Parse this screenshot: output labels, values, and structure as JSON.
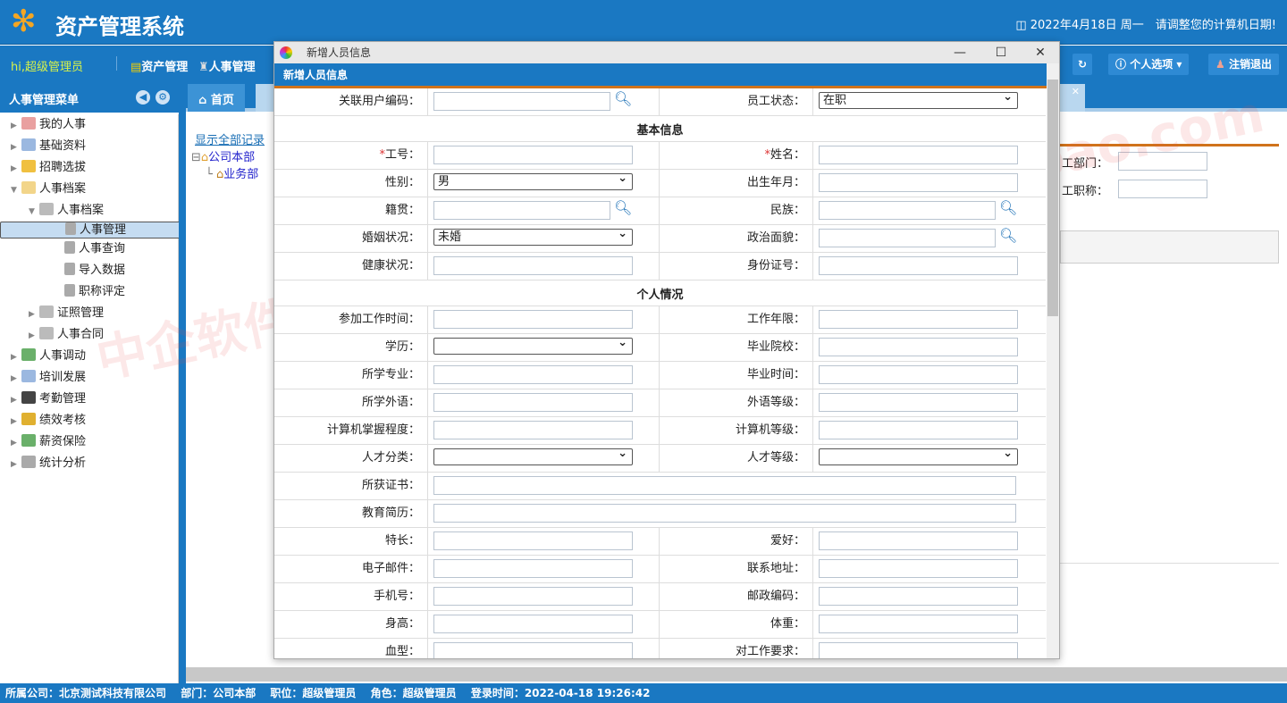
{
  "header": {
    "title": "资产管理系统",
    "date_notice": "◫ 2022年4月18日 周一　请调整您的计算机日期!"
  },
  "nav": {
    "greeting": "hi,超级管理员",
    "items": [
      "资产管理",
      "人事管理"
    ],
    "personal_label": "个人选项 ▾",
    "logout_label": "注销退出"
  },
  "sidebar": {
    "title": "人事管理菜单",
    "items": [
      {
        "label": "我的人事",
        "level": 0,
        "arrow": "▶",
        "color": "#e9a0a0"
      },
      {
        "label": "基础资料",
        "level": 0,
        "arrow": "▶",
        "color": "#9bb8e0"
      },
      {
        "label": "招聘选拔",
        "level": 0,
        "arrow": "▶",
        "color": "#f0c040"
      },
      {
        "label": "人事档案",
        "level": 0,
        "arrow": "▼",
        "color": "#f2d58a"
      },
      {
        "label": "人事档案",
        "level": 1,
        "arrow": "▼",
        "color": "#bbb"
      },
      {
        "label": "人事管理",
        "level": 2,
        "arrow": "",
        "color": "#aaa",
        "selected": true
      },
      {
        "label": "人事查询",
        "level": 2,
        "arrow": "",
        "color": "#aaa"
      },
      {
        "label": "导入数据",
        "level": 2,
        "arrow": "",
        "color": "#aaa"
      },
      {
        "label": "职称评定",
        "level": 2,
        "arrow": "",
        "color": "#aaa"
      },
      {
        "label": "证照管理",
        "level": 1,
        "arrow": "▶",
        "color": "#bbb"
      },
      {
        "label": "人事合同",
        "level": 1,
        "arrow": "▶",
        "color": "#bbb"
      },
      {
        "label": "人事调动",
        "level": 0,
        "arrow": "▶",
        "color": "#6ab06a"
      },
      {
        "label": "培训发展",
        "level": 0,
        "arrow": "▶",
        "color": "#9bb8e0"
      },
      {
        "label": "考勤管理",
        "level": 0,
        "arrow": "▶",
        "color": "#444"
      },
      {
        "label": "绩效考核",
        "level": 0,
        "arrow": "▶",
        "color": "#e0b030"
      },
      {
        "label": "薪资保险",
        "level": 0,
        "arrow": "▶",
        "color": "#6ab06a"
      },
      {
        "label": "统计分析",
        "level": 0,
        "arrow": "▶",
        "color": "#aaa"
      }
    ]
  },
  "tabs": {
    "home": "首页"
  },
  "org_tree": {
    "show_all": "显示全部记录",
    "root": "公司本部",
    "child": "业务部"
  },
  "background_form": {
    "dept_label": "工部门：",
    "title_label": "工职称："
  },
  "dialog": {
    "window_title": "新增人员信息",
    "header": "新增人员信息",
    "rows": [
      {
        "type": "pair",
        "l1": "关联用户编码：",
        "f1": "search",
        "l2": "员工状态：",
        "f2": "select",
        "v2": "在职"
      },
      {
        "type": "section",
        "label": "基本信息"
      },
      {
        "type": "pair",
        "l1": "工号：",
        "r1": true,
        "f1": "text",
        "l2": "姓名：",
        "r2": true,
        "f2": "text"
      },
      {
        "type": "pair",
        "l1": "性别：",
        "f1": "select",
        "v1": "男",
        "l2": "出生年月：",
        "f2": "text"
      },
      {
        "type": "pair",
        "l1": "籍贯：",
        "f1": "search",
        "l2": "民族：",
        "f2": "search"
      },
      {
        "type": "pair",
        "l1": "婚姻状况：",
        "f1": "select",
        "v1": "未婚",
        "l2": "政治面貌：",
        "f2": "search"
      },
      {
        "type": "pair",
        "l1": "健康状况：",
        "f1": "text",
        "l2": "身份证号：",
        "f2": "text"
      },
      {
        "type": "section",
        "label": "个人情况"
      },
      {
        "type": "pair",
        "l1": "参加工作时间：",
        "f1": "text",
        "l2": "工作年限：",
        "f2": "text"
      },
      {
        "type": "pair",
        "l1": "学历：",
        "f1": "select",
        "v1": "",
        "l2": "毕业院校：",
        "f2": "text"
      },
      {
        "type": "pair",
        "l1": "所学专业：",
        "f1": "text",
        "l2": "毕业时间：",
        "f2": "text"
      },
      {
        "type": "pair",
        "l1": "所学外语：",
        "f1": "text",
        "l2": "外语等级：",
        "f2": "text"
      },
      {
        "type": "pair",
        "l1": "计算机掌握程度：",
        "f1": "text",
        "l2": "计算机等级：",
        "f2": "text"
      },
      {
        "type": "pair",
        "l1": "人才分类：",
        "f1": "select",
        "v1": "",
        "l2": "人才等级：",
        "f2": "select",
        "v2": ""
      },
      {
        "type": "wide",
        "l1": "所获证书："
      },
      {
        "type": "wide",
        "l1": "教育简历："
      },
      {
        "type": "pair",
        "l1": "特长：",
        "f1": "text",
        "l2": "爱好：",
        "f2": "text"
      },
      {
        "type": "pair",
        "l1": "电子邮件：",
        "f1": "text",
        "l2": "联系地址：",
        "f2": "text"
      },
      {
        "type": "pair",
        "l1": "手机号：",
        "f1": "text",
        "l2": "邮政编码：",
        "f2": "text"
      },
      {
        "type": "pair",
        "l1": "身高：",
        "f1": "text",
        "l2": "体重：",
        "f2": "text"
      },
      {
        "type": "pair",
        "l1": "血型：",
        "f1": "text",
        "l2": "对工作要求：",
        "f2": "text"
      }
    ]
  },
  "status": {
    "company": "所属公司：北京测试科技有限公司",
    "dept": "部门：公司本部",
    "position": "职位：超级管理员",
    "role": "角色：超级管理员",
    "login_time": "登录时间：2022-04-18 19:26:42"
  },
  "watermark": "中企软件-https://shop13983775.taobao.com",
  "colors": {
    "primary": "#1a78c2",
    "accent": "#d0731b"
  }
}
